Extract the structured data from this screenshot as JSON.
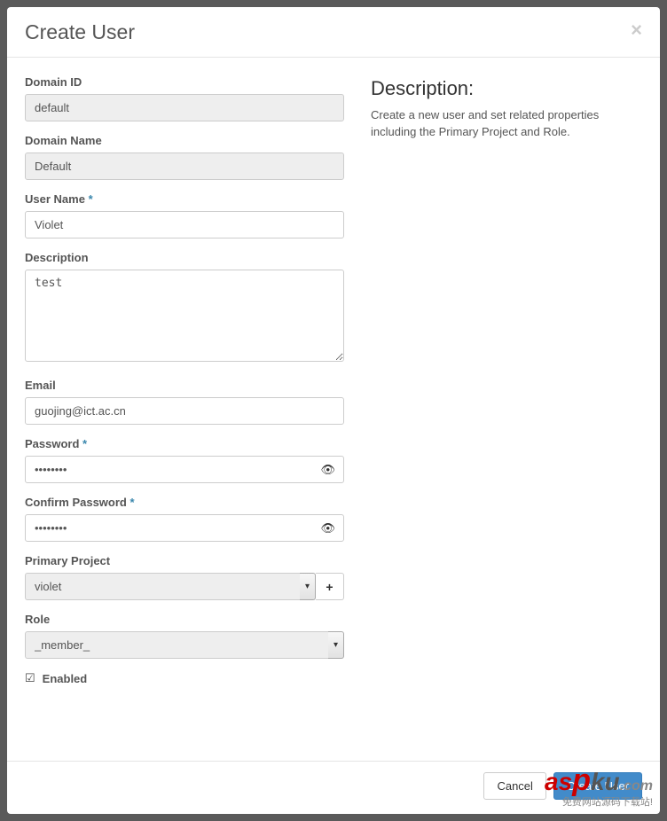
{
  "modal": {
    "title": "Create User",
    "close_glyph": "×"
  },
  "form": {
    "domain_id": {
      "label": "Domain ID",
      "value": "default"
    },
    "domain_name": {
      "label": "Domain Name",
      "value": "Default"
    },
    "user_name": {
      "label": "User Name",
      "value": "Violet"
    },
    "description": {
      "label": "Description",
      "value": "test"
    },
    "email": {
      "label": "Email",
      "value": "guojing@ict.ac.cn"
    },
    "password": {
      "label": "Password",
      "value": "••••••••"
    },
    "confirm_password": {
      "label": "Confirm Password",
      "value": "••••••••"
    },
    "primary_project": {
      "label": "Primary Project",
      "value": "violet"
    },
    "role": {
      "label": "Role",
      "value": "_member_"
    },
    "enabled": {
      "label": "Enabled",
      "checked": true
    }
  },
  "description_panel": {
    "title": "Description:",
    "text": "Create a new user and set related properties including the Primary Project and Role."
  },
  "footer": {
    "cancel": "Cancel",
    "submit": "Create User"
  },
  "glyphs": {
    "star": "*",
    "eye": "👁",
    "plus": "+",
    "caret": "▾",
    "checked": "☑"
  },
  "watermark": {
    "domain": ".com",
    "tagline": "免费网站源码下载站!"
  }
}
